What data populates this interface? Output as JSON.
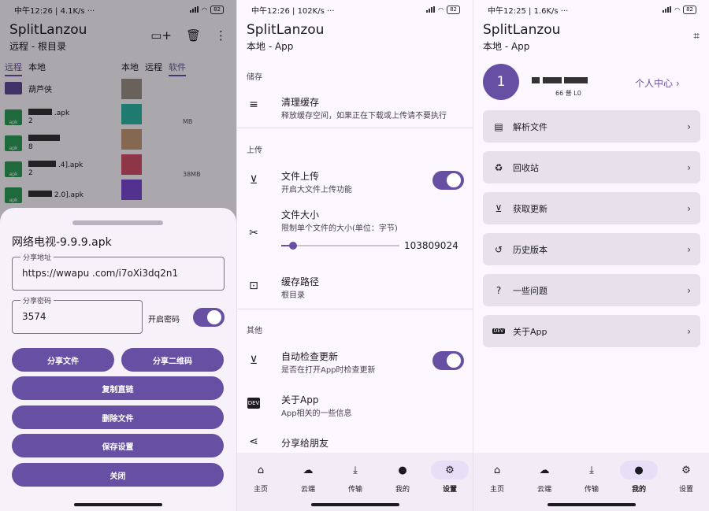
{
  "panel1": {
    "status": {
      "time": "中午12:26",
      "speed": "4.1K/s",
      "dots": "···",
      "battery": "82"
    },
    "title": "SplitLanzou",
    "subtitle": "远程 - 根目录",
    "tabs_left": [
      "远程",
      "本地"
    ],
    "tabs_right": [
      "本地",
      "远程",
      "软件"
    ],
    "folder_name": "葫芦侠",
    "files": [
      {
        "badge": "apk",
        "name_suffix": ".apk",
        "meta": "2"
      },
      {
        "badge": "apk",
        "name_suffix": "",
        "meta": "8"
      },
      {
        "badge": "apk",
        "name_suffix": ".4].apk",
        "meta": "2"
      },
      {
        "badge": "apk",
        "name_suffix": "2.0].apk",
        "meta": ""
      }
    ],
    "right_meta": [
      "MB",
      "38MB"
    ],
    "sheet": {
      "title": "网络电视-9.9.9.apk",
      "address_label": "分享地址",
      "address_value": "https://wwapu          .com/i7oXi3dq2n1",
      "password_label": "分享密码",
      "password_value": "3574",
      "enable_password_label": "开启密码",
      "buttons": {
        "share_file": "分享文件",
        "share_qr": "分享二维码",
        "copy_link": "复制直链",
        "delete_file": "删除文件",
        "save_settings": "保存设置",
        "close": "关闭"
      }
    }
  },
  "panel2": {
    "status": {
      "time": "中午12:26",
      "speed": "102K/s",
      "dots": "···",
      "battery": "82"
    },
    "title": "SplitLanzou",
    "subtitle": "本地 - App",
    "sections": {
      "storage": "储存",
      "upload": "上传",
      "other": "其他"
    },
    "items": {
      "clear_cache": {
        "title": "清理缓存",
        "desc": "释放缓存空间，如果正在下载或上传请不要执行"
      },
      "file_upload": {
        "title": "文件上传",
        "desc": "开启大文件上传功能"
      },
      "file_size": {
        "title": "文件大小",
        "desc": "限制单个文件的大小(单位：字节)",
        "value": "103809024",
        "slider_fraction": 0.1
      },
      "cache_path": {
        "title": "缓存路径",
        "desc": "根目录"
      },
      "auto_update": {
        "title": "自动检查更新",
        "desc": "是否在打开App时检查更新"
      },
      "about_app": {
        "title": "关于App",
        "desc": "App相关的一些信息"
      },
      "share_friends": {
        "title": "分享给朋友"
      }
    },
    "nav": [
      {
        "label": "主页",
        "icon": "home-icon"
      },
      {
        "label": "云端",
        "icon": "cloud-icon"
      },
      {
        "label": "传输",
        "icon": "download-icon"
      },
      {
        "label": "我的",
        "icon": "person-icon"
      },
      {
        "label": "设置",
        "icon": "gear-icon"
      }
    ],
    "active_nav": 4
  },
  "panel3": {
    "status": {
      "time": "中午12:25",
      "speed": "1.6K/s",
      "dots": "···",
      "battery": "82"
    },
    "title": "SplitLanzou",
    "subtitle": "本地 - App",
    "avatar_initial": "1",
    "user_level": "66 普 L0",
    "personal_center": "个人中心",
    "menu": [
      {
        "label": "解析文件",
        "icon": "parse-file-icon"
      },
      {
        "label": "回收站",
        "icon": "recycle-icon"
      },
      {
        "label": "获取更新",
        "icon": "update-icon"
      },
      {
        "label": "历史版本",
        "icon": "history-icon"
      },
      {
        "label": "一些问题",
        "icon": "help-icon"
      },
      {
        "label": "关于App",
        "icon": "dev-icon"
      }
    ],
    "nav": [
      {
        "label": "主页"
      },
      {
        "label": "云端"
      },
      {
        "label": "传输"
      },
      {
        "label": "我的"
      },
      {
        "label": "设置"
      }
    ],
    "active_nav": 3
  },
  "colors": {
    "primary": "#6750a4",
    "surface": "#fdf8ff",
    "card": "#e8e1ec",
    "nav_active": "#e8def8"
  }
}
